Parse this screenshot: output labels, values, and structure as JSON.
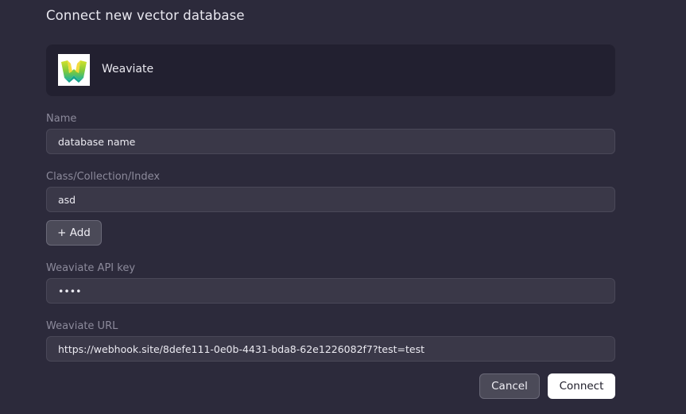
{
  "dialog": {
    "title": "Connect new vector database"
  },
  "provider": {
    "name": "Weaviate",
    "logo_icon": "weaviate-logo-icon",
    "logo_colors": [
      "#8bd13a",
      "#1fb8a1",
      "#f3d21a"
    ]
  },
  "fields": {
    "name": {
      "label": "Name",
      "value": "database name"
    },
    "class": {
      "label": "Class/Collection/Index",
      "value": "asd"
    },
    "add_label": "+ Add",
    "api_key": {
      "label": "Weaviate API key",
      "value": "••••"
    },
    "url": {
      "label": "Weaviate URL",
      "value": "https://webhook.site/8defe111-0e0b-4431-bda8-62e1226082f7?test=test"
    }
  },
  "actions": {
    "cancel_label": "Cancel",
    "connect_label": "Connect"
  },
  "colors": {
    "background": "#2c2a3b",
    "card": "#222030",
    "input": "#3a3848",
    "primary_button": "#ffffff"
  }
}
